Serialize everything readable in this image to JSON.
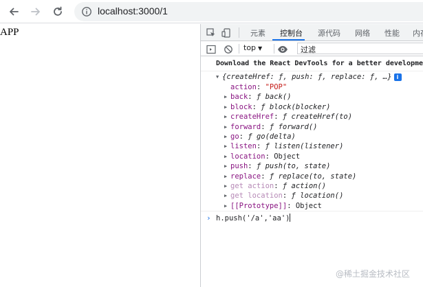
{
  "browser": {
    "url": "localhost:3000/1"
  },
  "page": {
    "text": "APP"
  },
  "devtools": {
    "tabs": [
      "元素",
      "控制台",
      "源代码",
      "网络",
      "性能",
      "内存"
    ],
    "active_tab": "控制台",
    "context": "top",
    "filter_placeholder": "过滤",
    "banner": "Download the React DevTools for a better development experience",
    "object": {
      "preview": "{createHref: ƒ, push: ƒ, replace: ƒ, …}",
      "info_badge": "i",
      "entries": [
        {
          "key": "action",
          "sep": ": ",
          "value": "\"POP\"",
          "kind": "string",
          "expandable": false,
          "dim": false
        },
        {
          "key": "back",
          "sep": ": ",
          "f": "ƒ ",
          "value": "back()",
          "kind": "fn",
          "expandable": true,
          "dim": false
        },
        {
          "key": "block",
          "sep": ": ",
          "f": "ƒ ",
          "value": "block(blocker)",
          "kind": "fn",
          "expandable": true,
          "dim": false
        },
        {
          "key": "createHref",
          "sep": ": ",
          "f": "ƒ ",
          "value": "createHref(to)",
          "kind": "fn",
          "expandable": true,
          "dim": false
        },
        {
          "key": "forward",
          "sep": ": ",
          "f": "ƒ ",
          "value": "forward()",
          "kind": "fn",
          "expandable": true,
          "dim": false
        },
        {
          "key": "go",
          "sep": ": ",
          "f": "ƒ ",
          "value": "go(delta)",
          "kind": "fn",
          "expandable": true,
          "dim": false
        },
        {
          "key": "listen",
          "sep": ": ",
          "f": "ƒ ",
          "value": "listen(listener)",
          "kind": "fn",
          "expandable": true,
          "dim": false
        },
        {
          "key": "location",
          "sep": ": ",
          "value": "Object",
          "kind": "plain",
          "expandable": true,
          "dim": false
        },
        {
          "key": "push",
          "sep": ": ",
          "f": "ƒ ",
          "value": "push(to, state)",
          "kind": "fn",
          "expandable": true,
          "dim": false
        },
        {
          "key": "replace",
          "sep": ": ",
          "f": "ƒ ",
          "value": "replace(to, state)",
          "kind": "fn",
          "expandable": true,
          "dim": false
        },
        {
          "key": "get action",
          "sep": ": ",
          "f": "ƒ ",
          "value": "action()",
          "kind": "fn",
          "expandable": true,
          "dim": true
        },
        {
          "key": "get location",
          "sep": ": ",
          "f": "ƒ ",
          "value": "location()",
          "kind": "fn",
          "expandable": true,
          "dim": true
        },
        {
          "key": "[[Prototype]]",
          "sep": ": ",
          "value": "Object",
          "kind": "plain",
          "expandable": true,
          "dim": false
        }
      ]
    },
    "prompt": {
      "caret": "›",
      "code": "h.push('/a','aa')"
    }
  },
  "watermark": "@稀土掘金技术社区",
  "colors": {
    "accent": "#1a73e8",
    "key": "#881280",
    "string": "#c41a16"
  }
}
